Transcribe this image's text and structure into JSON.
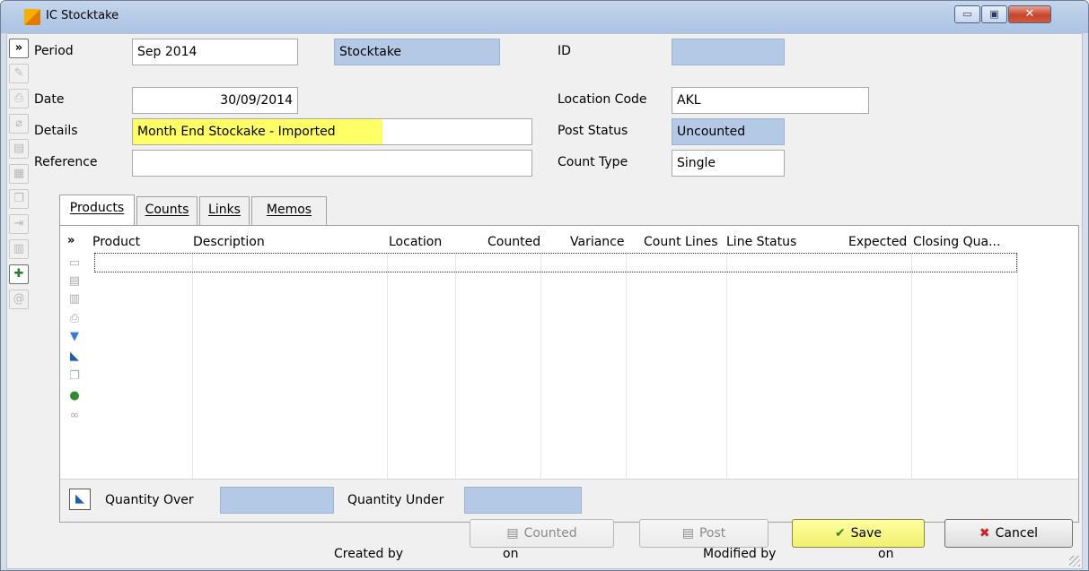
{
  "window": {
    "title": "IC Stocktake",
    "min_label": "▭",
    "max_label": "▣",
    "close_label": "✕"
  },
  "form": {
    "period_label": "Period",
    "period_value": "Sep 2014",
    "type_value": "Stocktake",
    "id_label": "ID",
    "id_value": "",
    "date_label": "Date",
    "date_value": "30/09/2014",
    "location_label": "Location Code",
    "location_value": "AKL",
    "details_label": "Details",
    "details_value": "Month End Stockake - Imported",
    "post_status_label": "Post Status",
    "post_status_value": "Uncounted",
    "reference_label": "Reference",
    "reference_value": "",
    "count_type_label": "Count Type",
    "count_type_value": "Single"
  },
  "sidebar": {
    "expand_label": "»"
  },
  "tabs": [
    {
      "label": "Products",
      "active": true
    },
    {
      "label": "Counts",
      "active": false
    },
    {
      "label": "Links",
      "active": false
    },
    {
      "label": "Memos",
      "active": false
    }
  ],
  "grid": {
    "expand_label": "»",
    "columns": [
      "Product",
      "Description",
      "Location",
      "Counted",
      "Variance",
      "Count Lines",
      "Line Status",
      "Expected",
      "Closing Qua..."
    ],
    "rows": []
  },
  "totals": {
    "quantity_over_label": "Quantity Over",
    "quantity_over_value": "",
    "quantity_under_label": "Quantity Under",
    "quantity_under_value": ""
  },
  "buttons": {
    "counted": "Counted",
    "post": "Post",
    "save": "Save",
    "cancel": "Cancel"
  },
  "footer": {
    "created_by_label": "Created by",
    "created_on_label": "on",
    "modified_by_label": "Modified by",
    "modified_on_label": "on"
  },
  "colors": {
    "readonly_field": "#b3c9e6",
    "highlight_field": "#ffff66",
    "save_button": "#f0f070",
    "cancel_icon": "#d32020"
  }
}
